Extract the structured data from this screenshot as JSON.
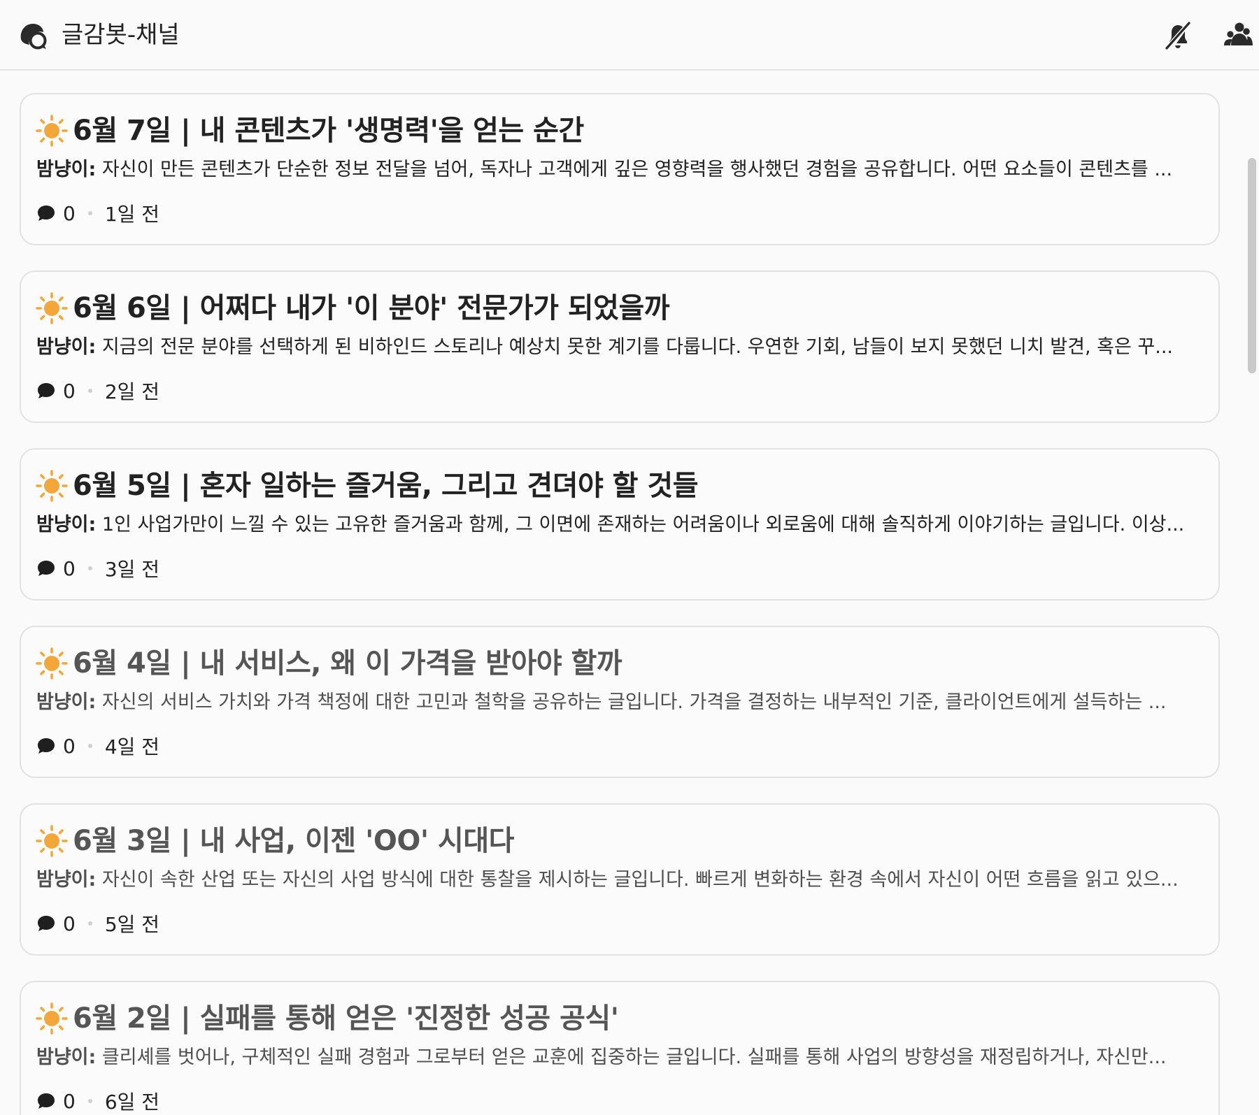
{
  "header": {
    "title": "글감봇-채널",
    "channel_icon": "channel-thread-icon",
    "mute_icon": "bell-slash-icon",
    "members_icon": "members-icon"
  },
  "colors": {
    "sun": "#f3a63a",
    "background": "#fafafa",
    "card_border": "#e2e2e2",
    "icon": "#2a2a2a"
  },
  "posts": [
    {
      "title": "6월 7일 | 내 콘텐츠가 '생명력'을 얻는 순간",
      "author": "밤냥이:",
      "summary": " 자신이 만든 콘텐츠가 단순한 정보 전달을 넘어, 독자나 고객에게 깊은 영향력을 행사했던 경험을 공유합니다. 어떤 요소들이 콘텐츠를 ...",
      "comments": "0",
      "time": "1일 전"
    },
    {
      "title": "6월 6일 | 어쩌다 내가 '이 분야' 전문가가 되었을까",
      "author": "밤냥이:",
      "summary": " 지금의 전문 분야를 선택하게 된 비하인드 스토리나 예상치 못한 계기를 다룹니다. 우연한 기회, 남들이 보지 못했던 니치 발견, 혹은 꾸...",
      "comments": "0",
      "time": "2일 전"
    },
    {
      "title": "6월 5일 | 혼자 일하는 즐거움, 그리고 견뎌야 할 것들",
      "author": "밤냥이:",
      "summary": " 1인 사업가만이 느낄 수 있는 고유한 즐거움과 함께, 그 이면에 존재하는 어려움이나 외로움에 대해 솔직하게 이야기하는 글입니다. 이상...",
      "comments": "0",
      "time": "3일 전"
    },
    {
      "title": "6월 4일 | 내 서비스, 왜 이 가격을 받아야 할까",
      "author": "밤냥이:",
      "summary": " 자신의 서비스 가치와 가격 책정에 대한 고민과 철학을 공유하는 글입니다. 가격을 결정하는 내부적인 기준, 클라이언트에게 설득하는 ...",
      "comments": "0",
      "time": "4일 전"
    },
    {
      "title": "6월 3일 | 내 사업, 이젠 'OO' 시대다",
      "author": "밤냥이:",
      "summary": " 자신이 속한 산업 또는 자신의 사업 방식에 대한 통찰을 제시하는 글입니다. 빠르게 변화하는 환경 속에서 자신이 어떤 흐름을 읽고 있으...",
      "comments": "0",
      "time": "5일 전"
    },
    {
      "title": "6월 2일 | 실패를 통해 얻은 '진정한 성공 공식'",
      "author": "밤냥이:",
      "summary": " 클리셰를 벗어나, 구체적인 실패 경험과 그로부터 얻은 교훈에 집중하는 글입니다. 실패를 통해 사업의 방향성을 재정립하거나, 자신만...",
      "comments": "0",
      "time": "6일 전"
    }
  ]
}
